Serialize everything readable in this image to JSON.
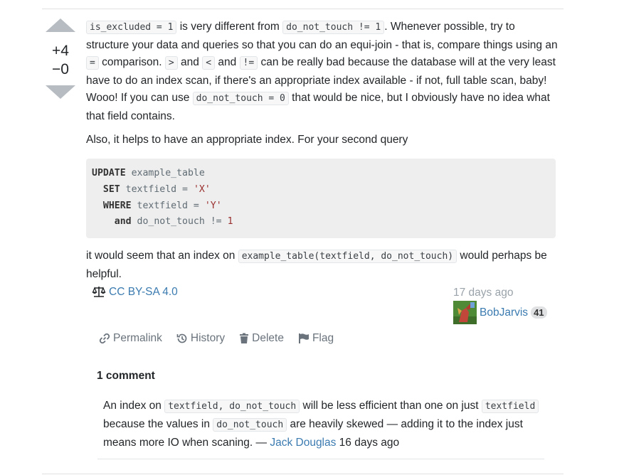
{
  "votes": {
    "up": "+4",
    "down": "−0"
  },
  "post": {
    "p1": {
      "code_a": "is_excluded = 1",
      "t1": " is very different from ",
      "code_b": "do_not_touch != 1",
      "t2": ". Whenever possible, try to structure your data and queries so that you can do an equi-join - that is, compare things using an ",
      "code_c": "=",
      "t3": " comparison. ",
      "code_d": ">",
      "t4": " and ",
      "code_e": "<",
      "t5": " and ",
      "code_f": "!=",
      "t6": " can be really bad because the database will at the very least have to do an index scan, if there's an appropriate index available - if not, full table scan, baby! Wooo! If you can use ",
      "code_g": "do_not_touch = 0",
      "t7": " that would be nice, but I obviously have no idea what that field contains."
    },
    "p2": "Also, it helps to have an appropriate index. For your second query",
    "code_block": {
      "l1_kw": "UPDATE",
      "l1_rest": " example_table",
      "l2_kw": "SET",
      "l2_rest": " textfield = ",
      "l2_str": "'X'",
      "l3_kw": "WHERE",
      "l3_rest": " textfield = ",
      "l3_str": "'Y'",
      "l4_kw": "and",
      "l4_rest": " do_not_touch != ",
      "l4_num": "1"
    },
    "p3": {
      "t1": "it would seem that an index on ",
      "code_a": "example_table(textfield, do_not_touch)",
      "t2": " would perhaps be helpful."
    }
  },
  "license": {
    "label": "CC BY-SA 4.0",
    "icon": "scale-icon"
  },
  "author": {
    "time": "17 days ago",
    "name": "BobJarvis",
    "rep": "41"
  },
  "actions": {
    "permalink": "Permalink",
    "history": "History",
    "delete": "Delete",
    "flag": "Flag"
  },
  "comments": {
    "title": "1 comment",
    "items": [
      {
        "t1": "An index on ",
        "code_a": "textfield, do_not_touch",
        "t2": " will be less efficient than one on just ",
        "code_b": "textfield",
        "t3": " because the values in ",
        "code_c": "do_not_touch",
        "t4": " are heavily skewed — adding it to the index just means more IO when scaning. — ",
        "author": "Jack Douglas",
        "time": " 16 days ago"
      }
    ]
  },
  "colors": {
    "link": "#3b7bb0",
    "muted": "#6a737c",
    "vote_arrow": "#b6bcc1",
    "code_bg": "#eeeeee"
  }
}
